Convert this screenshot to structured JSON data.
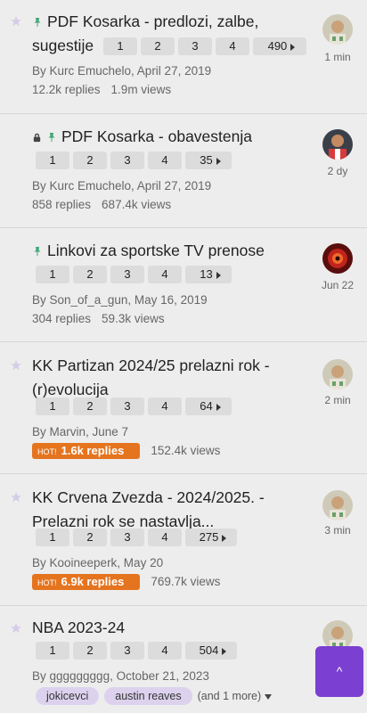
{
  "topics": [
    {
      "title": "PDF Kosarka - predlozi, zalbe, sugestije",
      "pages": [
        "1",
        "2",
        "3",
        "4",
        "490"
      ],
      "author_date": "By Kurc Emuchelo, April 27, 2019",
      "replies": "12.2k replies",
      "views": "1.9m views",
      "activity": "1 min"
    },
    {
      "title": "PDF Kosarka - obavestenja",
      "pages": [
        "1",
        "2",
        "3",
        "4",
        "35"
      ],
      "author_date": "By Kurc Emuchelo, April 27, 2019",
      "replies": "858 replies",
      "views": "687.4k views",
      "activity": "2 dy"
    },
    {
      "title": "Linkovi za sportske TV prenose",
      "pages": [
        "1",
        "2",
        "3",
        "4",
        "13"
      ],
      "author_date": "By Son_of_a_gun, May 16, 2019",
      "replies": "304 replies",
      "views": "59.3k views",
      "activity": "Jun 22"
    },
    {
      "title": "KK Partizan 2024/25 prelazni rok - (r)evolucija",
      "pages": [
        "1",
        "2",
        "3",
        "4",
        "64"
      ],
      "author_date": "By Marvin, June 7",
      "hot_label": "HOT!",
      "replies": "1.6k replies",
      "views": "152.4k views",
      "activity": "2 min"
    },
    {
      "title": "KK Crvena Zvezda - 2024/2025. - Prelazni rok se nastavlja...",
      "pages": [
        "1",
        "2",
        "3",
        "4",
        "275"
      ],
      "author_date": "By Kooineeperk, May 20",
      "hot_label": "HOT!",
      "replies": "6.9k replies",
      "views": "769.7k views",
      "activity": "3 min"
    },
    {
      "title": "NBA 2023-24",
      "pages": [
        "1",
        "2",
        "3",
        "4",
        "504"
      ],
      "author_date": "By ggggggggg, October 21, 2023",
      "tags": [
        "jokicevci",
        "austin reaves"
      ],
      "more_tags": "(and 1 more)"
    }
  ],
  "scroll_top_label": "^",
  "colors": {
    "hot": "#e5741f",
    "tag_bg": "#dcd2ee",
    "accent": "#7b3fd1",
    "pin": "#3fa776"
  }
}
